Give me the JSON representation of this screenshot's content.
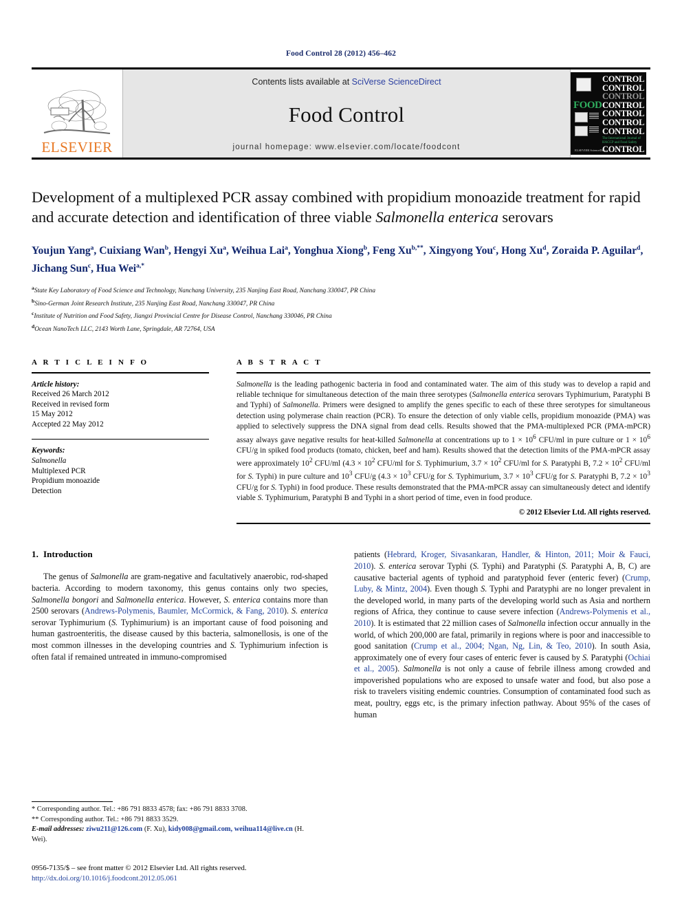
{
  "running_head": "Food Control 28 (2012) 456–462",
  "masthead": {
    "publisher_name": "ELSEVIER",
    "contents_prefix": "Contents lists available at ",
    "contents_link": "SciVerse ScienceDirect",
    "journal_name": "Food Control",
    "homepage": "journal homepage: www.elsevier.com/locate/foodcont",
    "cover": {
      "food_word": "FOOD",
      "control_word": "CONTROL",
      "tagline": "The International Journal of HACCP and Food Safety",
      "publisher_footer": "ELSEVIER ScienceDirect"
    }
  },
  "article": {
    "title_line_1": "Development of a multiplexed PCR assay combined with propidium monoazide",
    "title_line_2": "treatment for rapid and accurate detection and identification of three viable",
    "title_line_3_italic": "Salmonella enterica",
    "title_line_3_rest": " serovars",
    "authors": [
      {
        "name": "Youjun Yang",
        "sup": "a",
        "sep": ", "
      },
      {
        "name": "Cuixiang Wan",
        "sup": "b",
        "sep": ", "
      },
      {
        "name": "Hengyi Xu",
        "sup": "a",
        "sep": ", "
      },
      {
        "name": "Weihua Lai",
        "sup": "a",
        "sep": ", "
      },
      {
        "name": "Yonghua Xiong",
        "sup": "b",
        "sep": ", "
      },
      {
        "name": "Feng Xu",
        "sup": "b,**",
        "sep": ", "
      },
      {
        "name": "Xingyong You",
        "sup": "c",
        "sep": ", "
      },
      {
        "name": "Hong Xu",
        "sup": "d",
        "sep": ", "
      },
      {
        "name": "Zoraida P. Aguilar",
        "sup": "d",
        "sep": ", "
      },
      {
        "name": "Jichang Sun",
        "sup": "c",
        "sep": ", "
      },
      {
        "name": "Hua Wei",
        "sup": "a,*",
        "sep": ""
      }
    ],
    "affiliations": [
      {
        "mark": "a",
        "text": "State Key Laboratory of Food Science and Technology, Nanchang University, 235 Nanjing East Road, Nanchang 330047, PR China"
      },
      {
        "mark": "b",
        "text": "Sino-German Joint Research Institute, 235 Nanjing East Road, Nanchang 330047, PR China"
      },
      {
        "mark": "c",
        "text": "Institute of Nutrition and Food Safety, Jiangxi Provincial Centre for Disease Control, Nanchang 330046, PR China"
      },
      {
        "mark": "d",
        "text": "Ocean NanoTech LLC, 2143 Worth Lane, Springdale, AR 72764, USA"
      }
    ]
  },
  "article_info": {
    "heading": "A R T I C L E  I N F O",
    "history_label": "Article history:",
    "history_lines": [
      "Received 26 March 2012",
      "Received in revised form",
      "15 May 2012",
      "Accepted 22 May 2012"
    ],
    "keywords_label": "Keywords:",
    "keywords": [
      "Salmonella",
      "Multiplexed PCR",
      "Propidium monoazide",
      "Detection"
    ]
  },
  "abstract": {
    "heading": "A B S T R A C T",
    "body_html": "<em>Salmonella</em> is the leading pathogenic bacteria in food and contaminated water. The aim of this study was to develop a rapid and reliable technique for simultaneous detection of the main three serotypes (<em>Salmonella enterica</em> serovars Typhimurium, Paratyphi B and Typhi) of <em>Salmonella</em>. Primers were designed to amplify the genes specific to each of these three serotypes for simultaneous detection using polymerase chain reaction (PCR). To ensure the detection of only viable cells, propidium monoazide (PMA) was applied to selectively suppress the DNA signal from dead cells. Results showed that the PMA-multiplexed PCR (PMA-mPCR) assay always gave negative results for heat-killed <em>Salmonella</em> at concentrations up to 1 &times; 10<sup>6</sup> CFU/ml in pure culture or 1 &times; 10<sup>6</sup> CFU/g in spiked food products (tomato, chicken, beef and ham). Results showed that the detection limits of the PMA-mPCR assay were approximately 10<sup>2</sup> CFU/ml (4.3 &times; 10<sup>2</sup> CFU/ml for <em>S.</em> Typhimurium, 3.7 &times; 10<sup>2</sup> CFU/ml for <em>S.</em> Paratyphi B, 7.2 &times; 10<sup>2</sup> CFU/ml for <em>S.</em> Typhi) in pure culture and 10<sup>3</sup> CFU/g (4.3 &times; 10<sup>3</sup> CFU/g for <em>S.</em> Typhimurium, 3.7 &times; 10<sup>3</sup> CFU/g for <em>S.</em> Paratyphi B, 7.2 &times; 10<sup>3</sup> CFU/g for <em>S.</em> Typhi) in food produce. These results demonstrated that the PMA-mPCR assay can simultaneously detect and identify viable <em>S.</em> Typhimurium, Paratyphi B and Typhi in a short period of time, even in food produce.",
    "copyright": "© 2012 Elsevier Ltd. All rights reserved."
  },
  "introduction": {
    "number": "1.",
    "heading": "Introduction",
    "left_paragraph_html": "The genus of <em>Salmonella</em> are gram-negative and facultatively anaerobic, rod-shaped bacteria. According to modern taxonomy, this genus contains only two species, <em>Salmonella bongori</em> and <em>Salmonella enterica</em>. However, <em>S. enterica</em> contains more than 2500 serovars (<span class=\"cite\">Andrews-Polymenis, Baumler, McCormick, &amp; Fang, 2010</span>). <em>S. enterica</em> serovar Typhimurium (<em>S.</em> Typhimurium) is an important cause of food poisoning and human gastroenteritis, the disease caused by this bacteria, salmonellosis, is one of the most common illnesses in the developing countries and <em>S.</em> Typhimurium infection is often fatal if remained untreated in immuno-compromised",
    "right_paragraph_html": "patients (<span class=\"cite\">Hebrard, Kroger, Sivasankaran, Handler, &amp; Hinton, 2011; Moir &amp; Fauci, 2010</span>). <em>S. enterica</em> serovar Typhi (<em>S.</em> Typhi) and Paratyphi (<em>S.</em> Paratyphi A, B, C) are causative bacterial agents of typhoid and paratyphoid fever (enteric fever) (<span class=\"cite\">Crump, Luby, &amp; Mintz, 2004</span>). Even though <em>S.</em> Typhi and Paratyphi are no longer prevalent in the developed world, in many parts of the developing world such as Asia and northern regions of Africa, they continue to cause severe infection (<span class=\"cite\">Andrews-Polymenis et al., 2010</span>). It is estimated that 22 million cases of <em>Salmonella</em> infection occur annually in the world, of which 200,000 are fatal, primarily in regions where is poor and inaccessible to good sanitation (<span class=\"cite\">Crump et al., 2004; Ngan, Ng, Lin, &amp; Teo, 2010</span>). In south Asia, approximately one of every four cases of enteric fever is caused by <em>S.</em> Paratyphi (<span class=\"cite\">Ochiai et al., 2005</span>). <em>Salmonella</em> is not only a cause of febrile illness among crowded and impoverished populations who are exposed to unsafe water and food, but also pose a risk to travelers visiting endemic countries. Consumption of contaminated food such as meat, poultry, eggs etc, is the primary infection pathway. About 95% of the cases of human"
  },
  "footnotes": {
    "line_1": "* Corresponding author. Tel.: +86 791 8833 4578; fax: +86 791 8833 3708.",
    "line_2": "** Corresponding author. Tel.: +86 791 8833 3529.",
    "email_label": "E-mail addresses:",
    "email_1": "ziwu211@126.com",
    "email_1_owner": "(F. Xu),",
    "email_2": "kidy008@gmail.com, weihua114@live.cn",
    "email_2_owner": "(H. Wei)."
  },
  "front_matter": {
    "line": "0956-7135/$ – see front matter © 2012 Elsevier Ltd. All rights reserved.",
    "doi": "http://dx.doi.org/10.1016/j.foodcont.2012.05.061"
  }
}
